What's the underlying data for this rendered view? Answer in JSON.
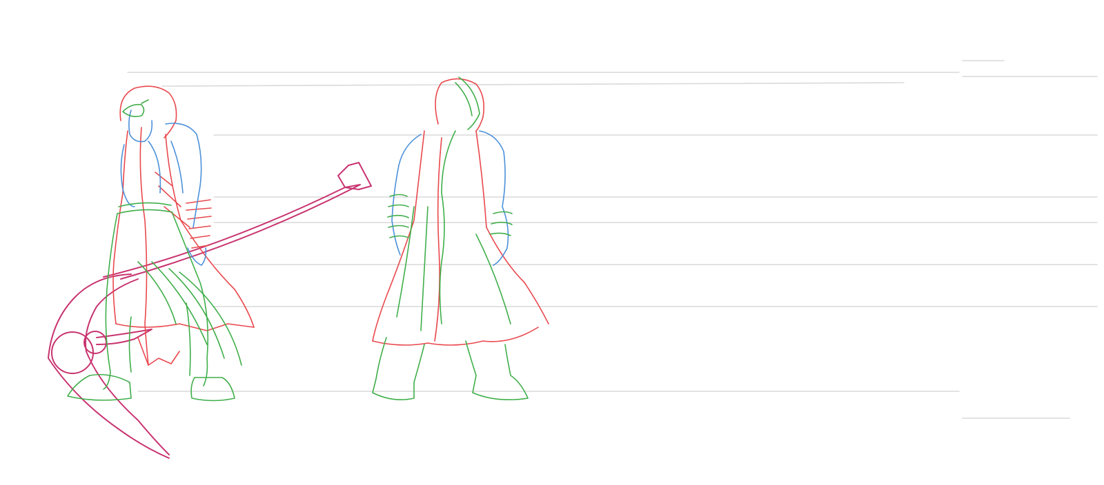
{
  "image": {
    "kind": "character-turnaround-sketch",
    "background": "#ffffff",
    "visible_text": []
  },
  "figures": [
    {
      "name": "hooded-figure-with-scythe",
      "view": "three-quarter-front"
    },
    {
      "name": "hooded-figure-back-view",
      "view": "back"
    }
  ],
  "colors": {
    "red": "#e8474c",
    "blue": "#4a90d9",
    "green": "#3fae49",
    "magenta": "#c8336f",
    "guide": "#d9d9d9"
  }
}
